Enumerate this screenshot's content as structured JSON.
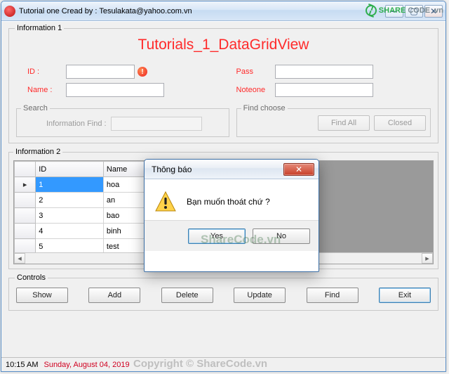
{
  "window": {
    "title": "Tutorial one Cread by : Tesulakata@yahoo.com.vn",
    "headline": "Tutorials_1_DataGridView"
  },
  "groups": {
    "info1": "Information 1",
    "info2": "Information 2",
    "search": "Search",
    "findchoose": "Find choose",
    "controls": "Controls"
  },
  "form": {
    "id_label": "ID :",
    "id_value": "",
    "pass_label": "Pass",
    "pass_value": "",
    "name_label": "Name :",
    "name_value": "",
    "note_label": "Noteone",
    "note_value": "",
    "info_find_label": "Information Find :",
    "info_find_value": "",
    "find_all": "Find All",
    "closed": "Closed"
  },
  "grid": {
    "col_id": "ID",
    "col_name": "Name",
    "rows": [
      {
        "id": "1",
        "name": "hoa"
      },
      {
        "id": "2",
        "name": "an"
      },
      {
        "id": "3",
        "name": "bao"
      },
      {
        "id": "4",
        "name": "binh"
      },
      {
        "id": "5",
        "name": "test"
      }
    ],
    "current_marker": "▸",
    "new_marker": "*"
  },
  "controls": {
    "show": "Show",
    "add": "Add",
    "delete": "Delete",
    "update": "Update",
    "find": "Find",
    "exit": "Exit"
  },
  "status": {
    "time": "10:15 AM",
    "date": "Sunday, August 04, 2019"
  },
  "dialog": {
    "title": "Thông báo",
    "message": "Bạn muốn thoát chứ ?",
    "yes": "Yes",
    "no": "No"
  },
  "watermark": {
    "brand_a": "SHARE",
    "brand_b": "CODE",
    "brand_c": ".vn",
    "center": "ShareCode.vn",
    "footer": "Copyright © ShareCode.vn"
  }
}
